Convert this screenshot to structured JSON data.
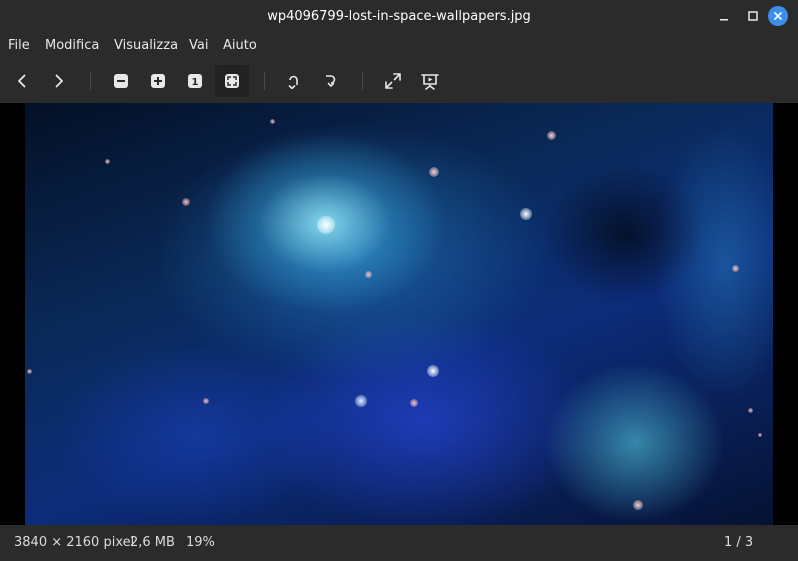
{
  "window": {
    "title": "wp4096799-lost-in-space-wallpapers.jpg"
  },
  "menu": {
    "items": [
      "File",
      "Modifica",
      "Visualizza",
      "Vai",
      "Aiuto"
    ]
  },
  "toolbar": {
    "buttons": [
      {
        "name": "previous-image-button",
        "icon": "chevron-left-icon"
      },
      {
        "name": "next-image-button",
        "icon": "chevron-right-icon"
      },
      {
        "name": "zoom-out-button",
        "icon": "zoom-out-icon"
      },
      {
        "name": "zoom-in-button",
        "icon": "zoom-in-icon"
      },
      {
        "name": "zoom-normal-button",
        "icon": "zoom-original-icon",
        "label": "1"
      },
      {
        "name": "zoom-fit-button",
        "icon": "zoom-fit-icon",
        "active": true
      },
      {
        "name": "rotate-left-button",
        "icon": "rotate-left-icon"
      },
      {
        "name": "rotate-right-button",
        "icon": "rotate-right-icon"
      },
      {
        "name": "fullscreen-button",
        "icon": "fullscreen-icon"
      },
      {
        "name": "slideshow-button",
        "icon": "slideshow-icon"
      }
    ],
    "zoom_normal_label": "1"
  },
  "status": {
    "dimensions": "3840 × 2160 pixel",
    "size": "2,6 MB",
    "zoom": "19%",
    "position": "1 / 3"
  },
  "colors": {
    "chrome_bg": "#2b2b2b",
    "close_button": "#3d8ee8",
    "viewer_bg": "#000000"
  }
}
